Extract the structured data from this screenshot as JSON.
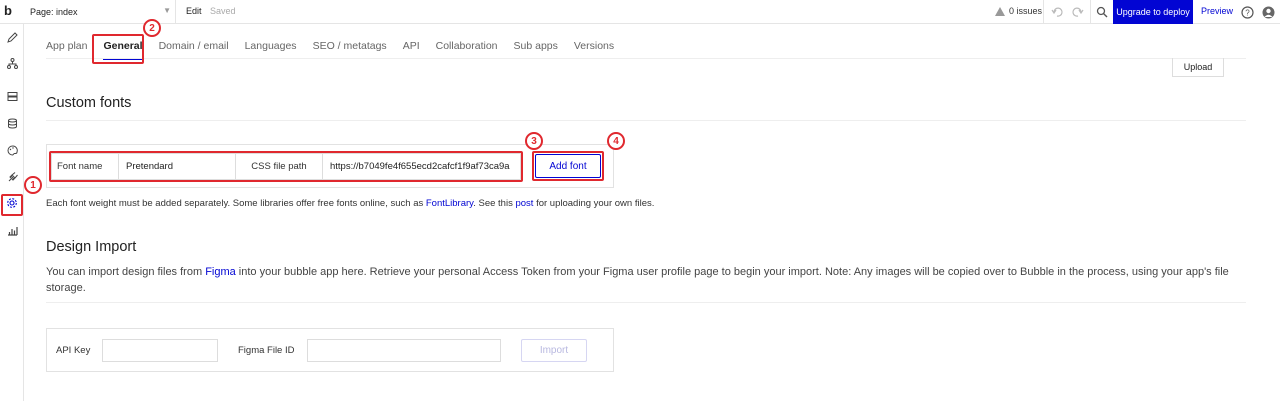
{
  "topbar": {
    "logo": "b",
    "page_label": "Page: index",
    "edit": "Edit",
    "saved": "Saved",
    "issues": "0 issues",
    "upgrade": "Upgrade to deploy",
    "preview": "Preview"
  },
  "rail": {
    "icons": [
      "pencil-icon",
      "workflow-icon",
      "data-icon",
      "database-icon",
      "palette-icon",
      "plugin-icon",
      "settings-icon",
      "chart-icon"
    ]
  },
  "tabs": [
    "App plan",
    "General",
    "Domain / email",
    "Languages",
    "SEO / metatags",
    "API",
    "Collaboration",
    "Sub apps",
    "Versions"
  ],
  "active_tab": "General",
  "upload_label": "Upload",
  "custom_fonts": {
    "heading": "Custom fonts",
    "font_name_label": "Font name",
    "font_name_value": "Pretendard",
    "css_path_label": "CSS file path",
    "css_path_value": "https://b7049fe4f655ecd2cafcf1f9af73ca9a",
    "add_button": "Add font",
    "help_prefix": "Each font weight must be added separately. Some libraries offer free fonts online, such as ",
    "help_link1": "FontLibrary",
    "help_mid": ". See this ",
    "help_link2": "post",
    "help_suffix": " for uploading your own files."
  },
  "design_import": {
    "heading": "Design Import",
    "text_prefix": "You can import design files from ",
    "text_link": "Figma",
    "text_suffix": " into your bubble app here. Retrieve your personal Access Token from your Figma user profile page to begin your import. Note: Any images will be copied over to Bubble in the process, using your app's file storage.",
    "api_key_label": "API Key",
    "figma_id_label": "Figma File ID",
    "import_button": "Import"
  },
  "annotations": [
    "1",
    "2",
    "3",
    "4"
  ],
  "colors": {
    "accent": "#0205d3",
    "annotation": "#e0282e"
  }
}
